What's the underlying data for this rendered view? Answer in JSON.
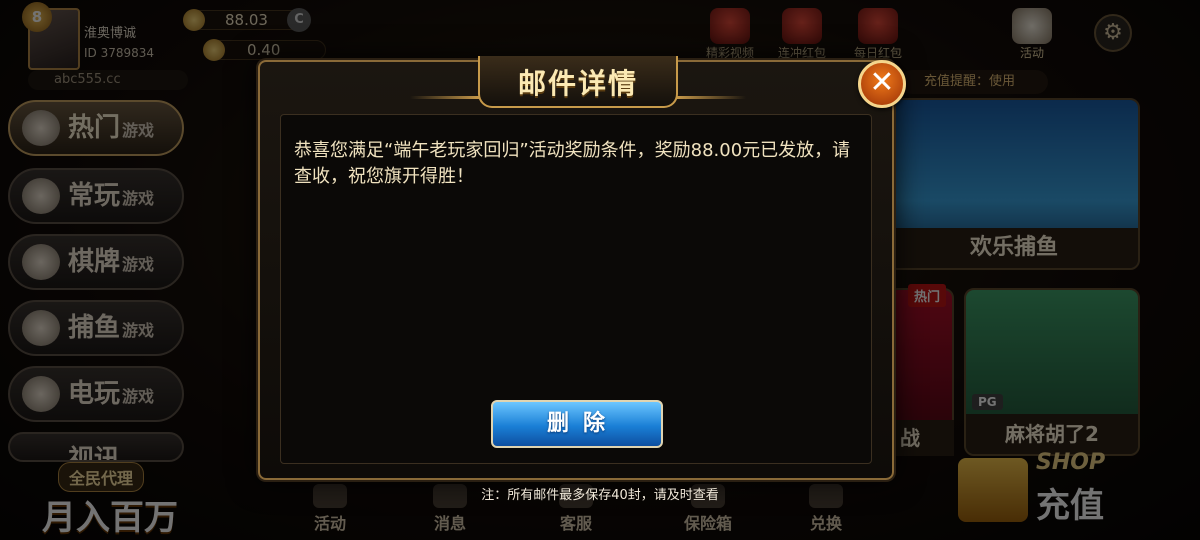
{
  "profile": {
    "vip_level": "8",
    "name": "淮奥博诚",
    "id_text": "ID 3789834",
    "site": "abc555.cc"
  },
  "balances": [
    {
      "value": "88.03"
    },
    {
      "value": "0.40"
    }
  ],
  "top_icons": [
    {
      "label": "精彩视频"
    },
    {
      "label": "连冲红包"
    },
    {
      "label": "每日红包"
    },
    {
      "label": "活动"
    }
  ],
  "notice": "充值提醒：使用",
  "sidebar": [
    {
      "label": "热门",
      "suffix": "游戏",
      "active": true
    },
    {
      "label": "常玩",
      "suffix": "游戏",
      "active": false
    },
    {
      "label": "棋牌",
      "suffix": "游戏",
      "active": false
    },
    {
      "label": "捕鱼",
      "suffix": "游戏",
      "active": false
    },
    {
      "label": "电玩",
      "suffix": "游戏",
      "active": false
    },
    {
      "label": "视讯",
      "suffix": "",
      "active": false
    }
  ],
  "promo": {
    "line1": "全民代理",
    "line2": "月入百万"
  },
  "games": {
    "card1": "欢乐捕鱼",
    "hot_badge": "热门",
    "card2": "战",
    "card3": "麻将胡了2",
    "card3_badge": "PG"
  },
  "bottom_nav": [
    {
      "label": "活动"
    },
    {
      "label": "消息"
    },
    {
      "label": "客服"
    },
    {
      "label": "保险箱"
    },
    {
      "label": "兑换"
    }
  ],
  "shop": {
    "en": "SHOP",
    "cn": "充值"
  },
  "modal": {
    "title": "邮件详情",
    "close_glyph": "✕",
    "body": "恭喜您满足“端午老玩家回归”活动奖励条件，奖励88.00元已发放，请查收，祝您旗开得胜！",
    "delete_label": "删除",
    "footnote": "注：所有邮件最多保存40封，请及时查看"
  },
  "colors": {
    "accent_gold": "#c79a4a",
    "close_orange": "#f07a1a",
    "delete_blue": "#1a7fd6"
  }
}
